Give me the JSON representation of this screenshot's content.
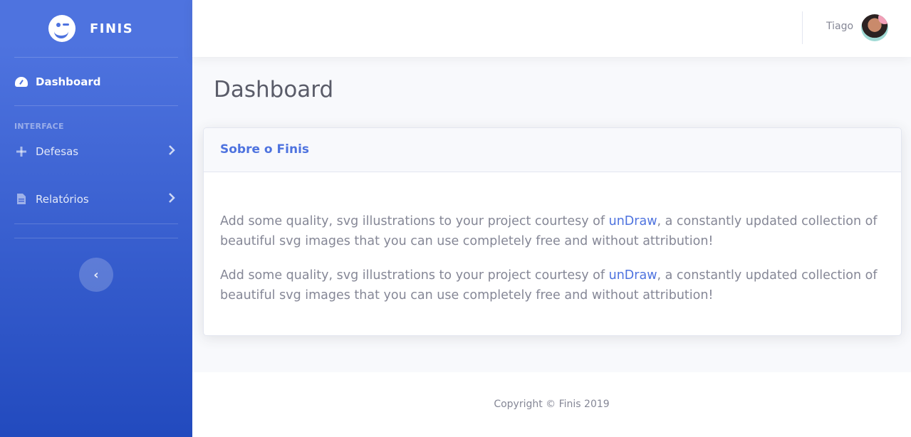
{
  "brand": {
    "name": "FINIS"
  },
  "sidebar": {
    "items": [
      {
        "label": "Dashboard",
        "icon": "tachometer-icon"
      },
      {
        "label": "Defesas",
        "icon": "plus-icon"
      },
      {
        "label": "Relatórios",
        "icon": "file-icon"
      }
    ],
    "heading": "INTERFACE",
    "toggle_icon": "‹"
  },
  "topbar": {
    "user_name": "Tiago"
  },
  "main": {
    "title": "Dashboard",
    "card": {
      "title": "Sobre o Finis",
      "paragraphs": [
        {
          "before": "Add some quality, svg illustrations to your project courtesy of ",
          "link": "unDraw",
          "after": ", a constantly updated collection of beautiful svg images that you can use completely free and without attribution!"
        },
        {
          "before": "Add some quality, svg illustrations to your project courtesy of ",
          "link": "unDraw",
          "after": ", a constantly updated collection of beautiful svg images that you can use completely free and without attribution!"
        }
      ]
    }
  },
  "footer": {
    "copyright": "Copyright © Finis 2019"
  },
  "colors": {
    "primary": "#4e73df",
    "primary_dark": "#224abe",
    "text_muted": "#858796",
    "title": "#5a5c69"
  }
}
